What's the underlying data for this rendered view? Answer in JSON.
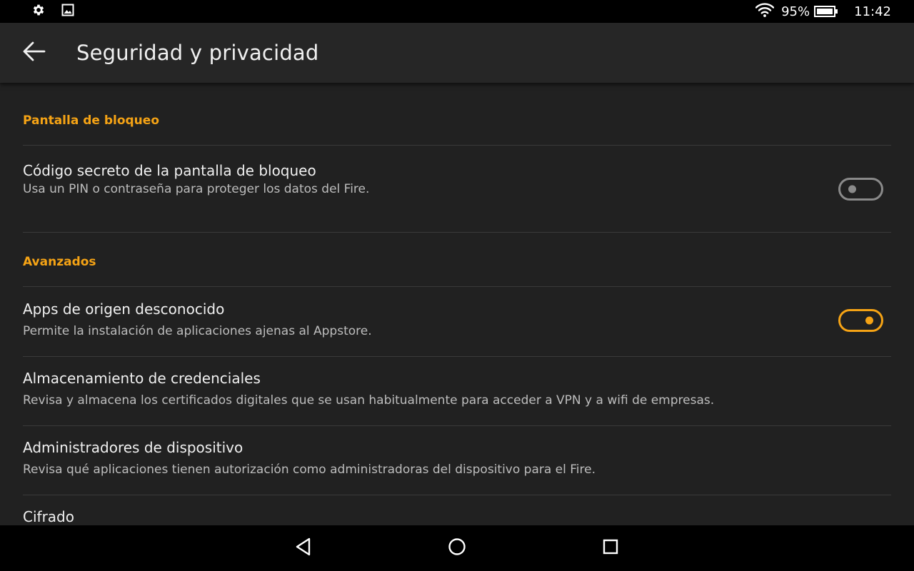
{
  "status_bar": {
    "left_icons": [
      "gear-icon",
      "image-icon"
    ],
    "battery_percent": "95%",
    "time": "11:42",
    "right_icons": [
      "wifi-icon",
      "battery-icon"
    ]
  },
  "header": {
    "title": "Seguridad y privacidad",
    "back_icon": "arrow-left-icon"
  },
  "sections": {
    "lock_screen": {
      "header": "Pantalla de bloqueo",
      "items": [
        {
          "title": "Código secreto de la pantalla de bloqueo",
          "subtitle": "Usa un PIN o contraseña para proteger los datos del Fire.",
          "toggle": "off"
        }
      ]
    },
    "advanced": {
      "header": "Avanzados",
      "items": [
        {
          "title": "Apps de origen desconocido",
          "subtitle": "Permite la instalación de aplicaciones ajenas al Appstore.",
          "toggle": "on"
        },
        {
          "title": "Almacenamiento de credenciales",
          "subtitle": "Revisa y almacena los certificados digitales que se usan habitualmente para acceder a VPN y a wifi de empresas."
        },
        {
          "title": "Administradores de dispositivo",
          "subtitle": "Revisa qué aplicaciones tienen autorización como administradoras del dispositivo para el Fire."
        },
        {
          "title": "Cifrado"
        }
      ]
    }
  },
  "nav_bar": {
    "buttons": [
      "back-triangle-icon",
      "home-circle-icon",
      "recents-square-icon"
    ]
  },
  "colors": {
    "accent": "#f5a315",
    "background": "#212121",
    "app_bar": "#262626",
    "toggle_off": "#8a8a8a"
  }
}
